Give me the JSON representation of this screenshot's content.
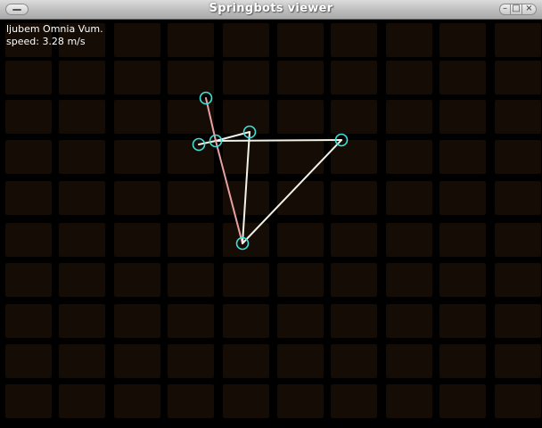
{
  "window": {
    "title": "Springbots viewer"
  },
  "hud": {
    "creature_name": "ljubem Omnia Vum.",
    "speed_label": "speed:",
    "speed_value": "3.28",
    "speed_unit": "m/s"
  },
  "colors": {
    "background": "#000000",
    "grid_cell": "#140c05",
    "node_stroke": "#40e0d8",
    "spring_white": "#f2f2e6",
    "spring_red": "#e8a0a0",
    "text": "#ffffff"
  },
  "springbot": {
    "nodes": [
      {
        "id": "n-top"
      },
      {
        "id": "n-left"
      },
      {
        "id": "n-hub"
      },
      {
        "id": "n-mid"
      },
      {
        "id": "n-right"
      },
      {
        "id": "n-bottom"
      }
    ],
    "springs": [
      {
        "from": "n-top",
        "to": "n-hub",
        "tone": "red"
      },
      {
        "from": "n-left",
        "to": "n-hub",
        "tone": "white"
      },
      {
        "from": "n-hub",
        "to": "n-mid",
        "tone": "white"
      },
      {
        "from": "n-hub",
        "to": "n-right",
        "tone": "white"
      },
      {
        "from": "n-hub",
        "to": "n-bottom",
        "tone": "red"
      },
      {
        "from": "n-mid",
        "to": "n-bottom",
        "tone": "white"
      },
      {
        "from": "n-right",
        "to": "n-bottom",
        "tone": "white"
      }
    ]
  }
}
